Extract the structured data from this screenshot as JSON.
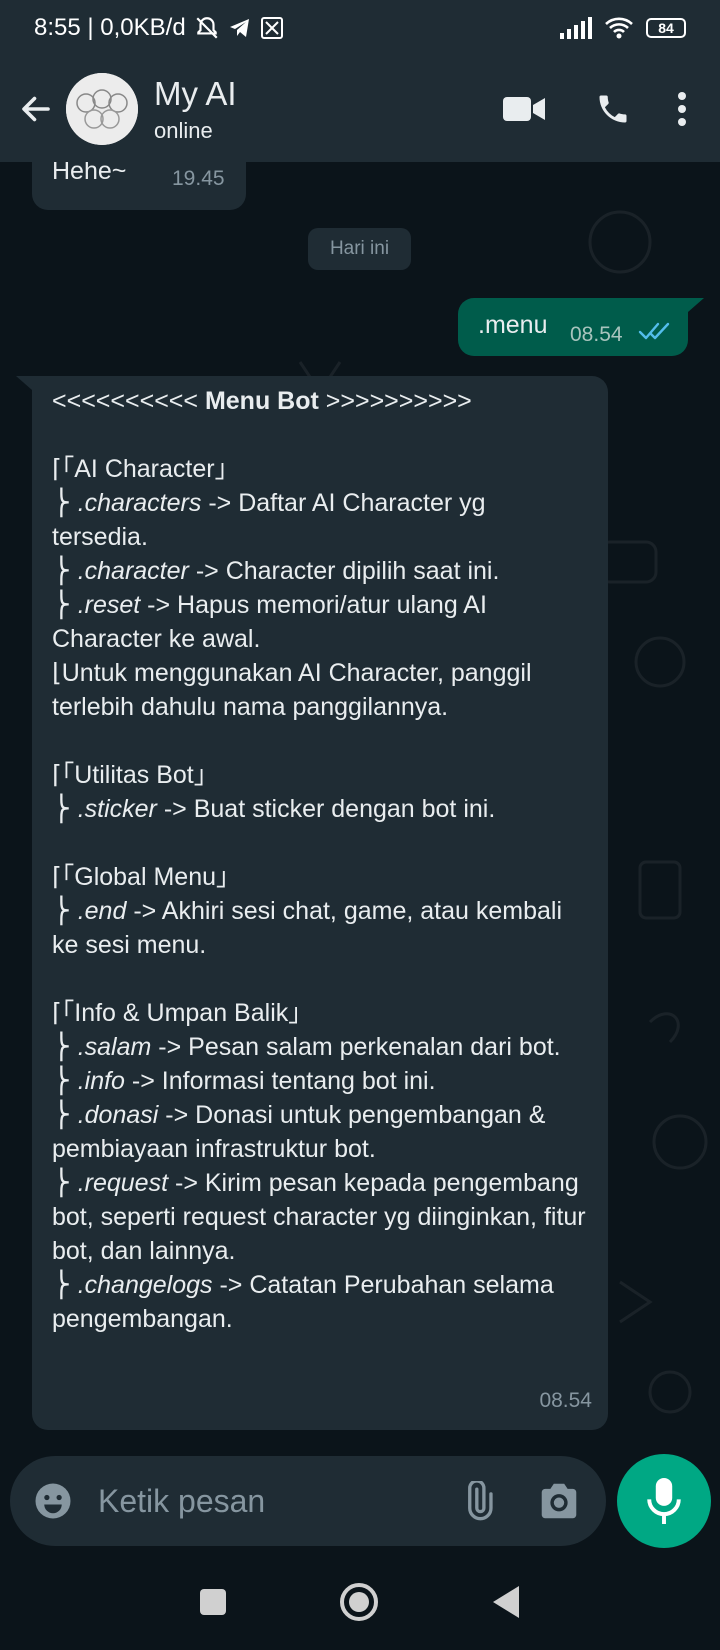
{
  "status_bar": {
    "time_info": "8:55 | 0,0KB/d",
    "battery": "84"
  },
  "header": {
    "name": "My AI",
    "status": "online"
  },
  "messages": {
    "first_in": {
      "text": "Hehe~",
      "time": "19.45"
    },
    "day_chip": "Hari ini",
    "out": {
      "text": ".menu",
      "time": "08.54",
      "ticks": "read"
    },
    "menu": {
      "title_left": "<<<<<<<<<< ",
      "title": "Menu Bot",
      "title_right": " >>>>>>>>>>",
      "s1_head": "⌈「AI Character」",
      "s1_l1_cmd": ".characters",
      "s1_l1_text": " -> Daftar AI Character yg tersedia.",
      "s1_l2_cmd": ".character",
      "s1_l2_text": " -> Character dipilih saat ini.",
      "s1_l3_cmd": ".reset",
      "s1_l3_text": " -> Hapus memori/atur ulang AI Character ke awal.",
      "s1_note": "⌊Untuk menggunakan AI Character, panggil terlebih dahulu nama panggilannya.",
      "s2_head": "⌈「Utilitas Bot」",
      "s2_l1_cmd": ".sticker",
      "s2_l1_text": " -> Buat sticker dengan bot ini.",
      "s3_head": "⌈「Global Menu」",
      "s3_l1_cmd": ".end",
      "s3_l1_text": " -> Akhiri sesi chat, game, atau kembali ke sesi menu.",
      "s4_head": "⌈「Info & Umpan Balik」",
      "s4_l1_cmd": ".salam",
      "s4_l1_text": " -> Pesan salam perkenalan dari bot.",
      "s4_l2_cmd": ".info",
      "s4_l2_text": " -> Informasi tentang bot ini.",
      "s4_l3_cmd": ".donasi",
      "s4_l3_text": " -> Donasi untuk pengembangan & pembiayaan infrastruktur bot.",
      "s4_l4_cmd": ".request",
      "s4_l4_text": " -> Kirim pesan kepada pengembang bot, seperti request character yg diinginkan, fitur bot, dan lainnya.",
      "s4_l5_cmd": ".changelogs",
      "s4_l5_text": " -> Catatan Perubahan selama pengembangan.",
      "time": "08.54"
    }
  },
  "composer": {
    "placeholder": "Ketik pesan"
  },
  "colors": {
    "header_bg": "#1f2c34",
    "chat_bg": "#0b141a",
    "incoming_bubble": "#1f2c34",
    "outgoing_bubble": "#005c4b",
    "accent": "#00a884",
    "read_tick": "#53bdeb"
  },
  "icons": [
    "back-arrow-icon",
    "video-call-icon",
    "phone-icon",
    "more-vert-icon",
    "emoji-icon",
    "attach-icon",
    "camera-icon",
    "mic-icon"
  ]
}
